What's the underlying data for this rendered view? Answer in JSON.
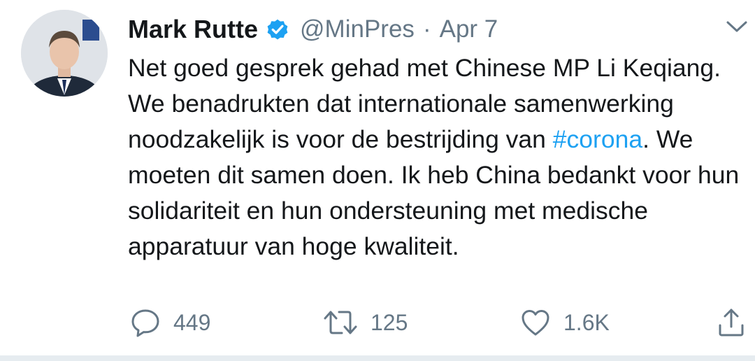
{
  "tweet": {
    "author_name": "Mark Rutte",
    "handle": "@MinPres",
    "separator": "·",
    "date": "Apr 7",
    "text_before_hashtag": "Net goed gesprek gehad met Chinese MP Li Keqiang. We benadrukten dat internationale samenwerking noodzakelijk is voor de bestrijding van ",
    "hashtag": "#corona",
    "text_after_hashtag": ". We moeten dit samen doen. Ik heb China bedankt voor hun solidariteit en hun ondersteuning met medische apparatuur van hoge kwaliteit."
  },
  "actions": {
    "replies": "449",
    "retweets": "125",
    "likes": "1.6K"
  },
  "icons": {
    "verified": "verified-badge-icon",
    "caret": "chevron-down-icon",
    "reply": "reply-icon",
    "retweet": "retweet-icon",
    "like": "heart-icon",
    "share": "share-icon"
  },
  "colors": {
    "text": "#14171a",
    "secondary": "#657786",
    "accent": "#1da1f2",
    "divider": "#e6ecf0"
  }
}
